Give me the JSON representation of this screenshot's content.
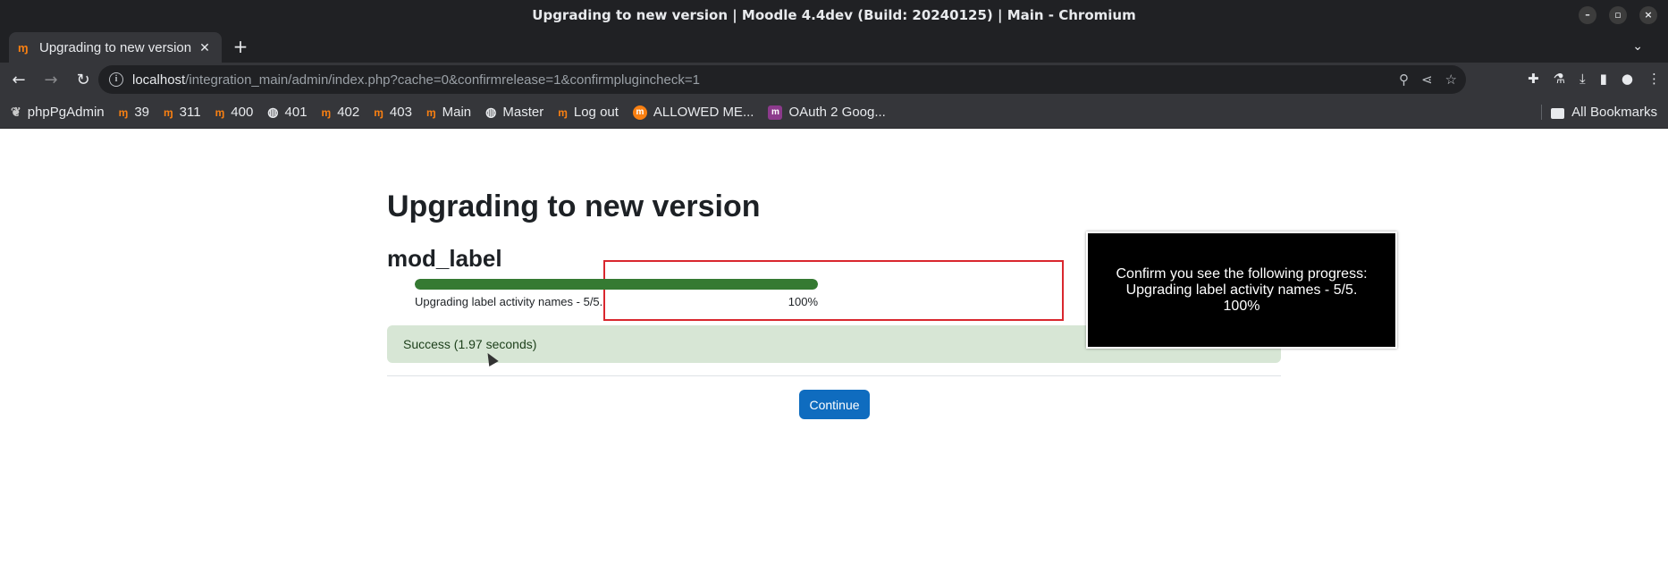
{
  "window": {
    "title": "Upgrading to new version | Moodle 4.4dev (Build: 20240125) | Main - Chromium",
    "controls": [
      "–",
      "▫",
      "×"
    ]
  },
  "tabs": [
    {
      "title": "Upgrading to new version",
      "favicon": "moodle-icon"
    }
  ],
  "toolbar": {
    "url_host": "localhost",
    "url_path": "/integration_main/admin/index.php?cache=0&confirmrelease=1&confirmplugincheck=1"
  },
  "bookmarks": [
    {
      "label": "phpPgAdmin",
      "icon": "elephant-icon"
    },
    {
      "label": "39",
      "icon": "moodle-icon"
    },
    {
      "label": "311",
      "icon": "moodle-icon"
    },
    {
      "label": "400",
      "icon": "moodle-icon"
    },
    {
      "label": "401",
      "icon": "globe-icon"
    },
    {
      "label": "402",
      "icon": "moodle-icon"
    },
    {
      "label": "403",
      "icon": "moodle-icon"
    },
    {
      "label": "Main",
      "icon": "moodle-icon"
    },
    {
      "label": "Master",
      "icon": "globe-icon"
    },
    {
      "label": "Log out",
      "icon": "moodle-icon"
    },
    {
      "label": "ALLOWED ME...",
      "icon": "moodle-circle-icon"
    },
    {
      "label": "OAuth 2 Goog...",
      "icon": "oauth-icon"
    }
  ],
  "all_bookmarks_label": "All Bookmarks",
  "page": {
    "title": "Upgrading to new version",
    "plugin": "mod_label",
    "progress": {
      "label": "Upgrading label activity names - 5/5.",
      "percent_text": "100%",
      "value": 1.0
    },
    "success": "Success (1.97 seconds)",
    "continue_label": "Continue"
  },
  "overlay": {
    "line1": "Confirm you see the following progress:",
    "line2": "Upgrading label activity names - 5/5.",
    "line3": "100%"
  },
  "colors": {
    "progress_fill": "#357a32",
    "success_bg": "#d7e6d5",
    "primary_button": "#0f6cbf",
    "highlight_border": "#d9272e"
  }
}
